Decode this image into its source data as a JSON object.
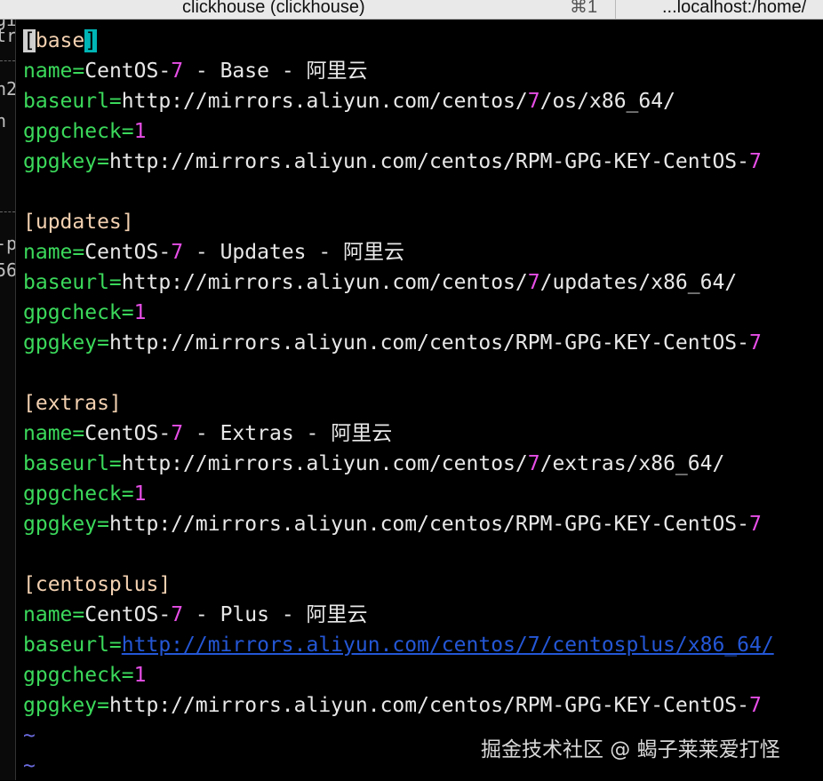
{
  "tabs": [
    {
      "title": "clickhouse (clickhouse)",
      "shortcut": "⌘1"
    },
    {
      "title": "...localhost:/home/"
    }
  ],
  "left_pane_fragments": [
    "gi",
    "tr",
    "n2",
    "n",
    "-p",
    "56"
  ],
  "editor": {
    "sections": [
      {
        "header": "[base]",
        "name_key": "name=",
        "name_pre": "CentOS-",
        "name_num": "7",
        "name_post": " - Base - 阿里云",
        "baseurl_key": "baseurl=",
        "baseurl_pre": "http://mirrors.aliyun.com/centos/",
        "baseurl_num": "7",
        "baseurl_post": "/os/x86_64/",
        "gpgcheck_key": "gpgcheck=",
        "gpgcheck_val": "1",
        "gpgkey_key": "gpgkey=",
        "gpgkey_pre": "http://mirrors.aliyun.com/centos/RPM-GPG-KEY-CentOS-",
        "gpgkey_num": "7"
      },
      {
        "header": "[updates]",
        "name_key": "name=",
        "name_pre": "CentOS-",
        "name_num": "7",
        "name_post": " - Updates - 阿里云",
        "baseurl_key": "baseurl=",
        "baseurl_pre": "http://mirrors.aliyun.com/centos/",
        "baseurl_num": "7",
        "baseurl_post": "/updates/x86_64/",
        "gpgcheck_key": "gpgcheck=",
        "gpgcheck_val": "1",
        "gpgkey_key": "gpgkey=",
        "gpgkey_pre": "http://mirrors.aliyun.com/centos/RPM-GPG-KEY-CentOS-",
        "gpgkey_num": "7"
      },
      {
        "header": "[extras]",
        "name_key": "name=",
        "name_pre": "CentOS-",
        "name_num": "7",
        "name_post": " - Extras - 阿里云",
        "baseurl_key": "baseurl=",
        "baseurl_pre": "http://mirrors.aliyun.com/centos/",
        "baseurl_num": "7",
        "baseurl_post": "/extras/x86_64/",
        "gpgcheck_key": "gpgcheck=",
        "gpgcheck_val": "1",
        "gpgkey_key": "gpgkey=",
        "gpgkey_pre": "http://mirrors.aliyun.com/centos/RPM-GPG-KEY-CentOS-",
        "gpgkey_num": "7"
      },
      {
        "header": "[centosplus]",
        "name_key": "name=",
        "name_pre": "CentOS-",
        "name_num": "7",
        "name_post": " - Plus - 阿里云",
        "baseurl_key": "baseurl=",
        "baseurl_link": "http://mirrors.aliyun.com/centos/7/centosplus/x86_64/",
        "gpgcheck_key": "gpgcheck=",
        "gpgcheck_val": "1",
        "gpgkey_key": "gpgkey=",
        "gpgkey_pre": "http://mirrors.aliyun.com/centos/RPM-GPG-KEY-CentOS-",
        "gpgkey_num": "7"
      }
    ],
    "tilde": "~"
  },
  "watermark": "掘金技术社区 @ 蝎子莱莱爱打怪",
  "colors": {
    "background": "#000000",
    "section_header": "#f2d0b0",
    "key": "#3bd95b",
    "number": "#e64ee6",
    "link": "#2457d6",
    "tilde": "#6b6bdf"
  }
}
